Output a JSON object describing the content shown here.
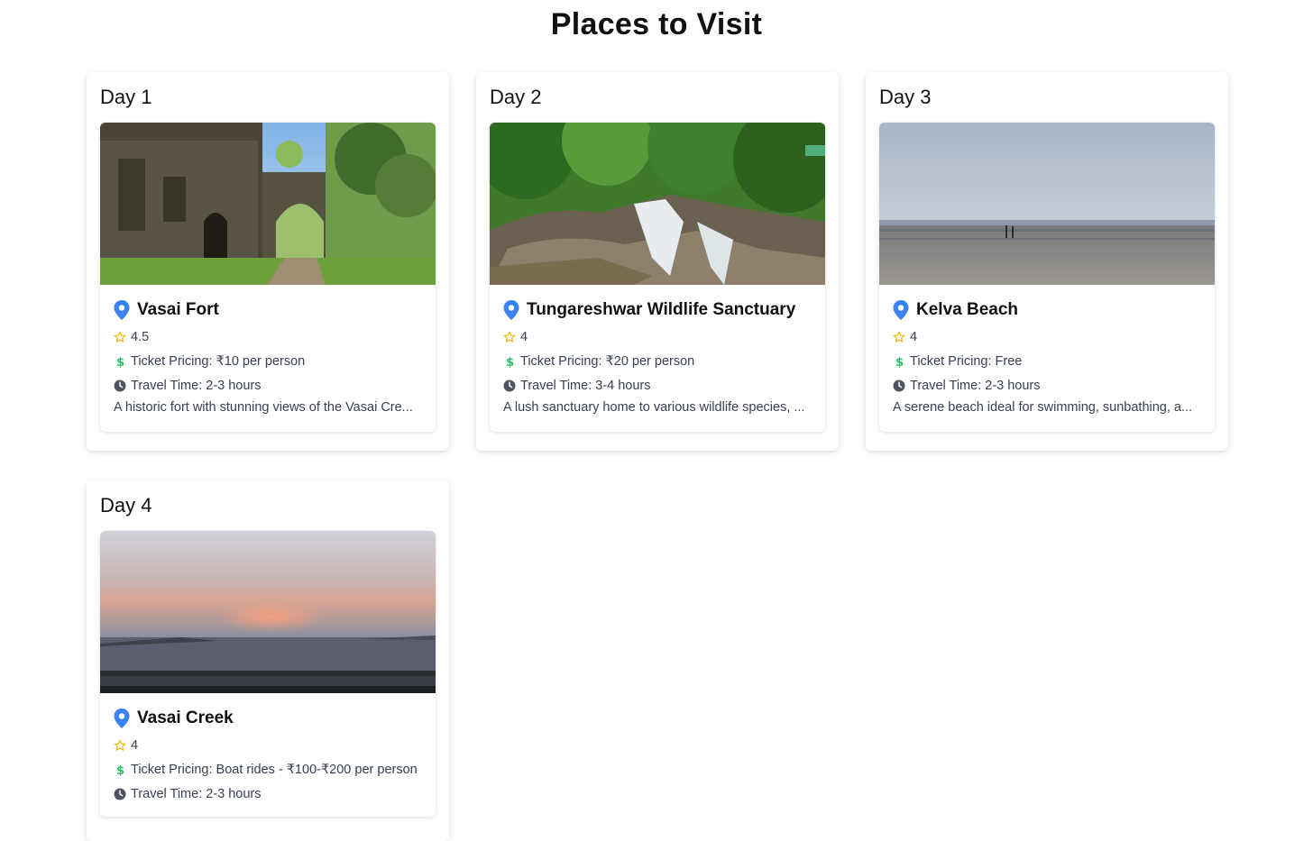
{
  "page": {
    "title": "Places to Visit"
  },
  "colors": {
    "pin": "#3b82f6",
    "star": "#f5b301",
    "dollar": "#22c55e",
    "clock": "#4b5563"
  },
  "days": [
    {
      "label": "Day 1",
      "place": {
        "name": "Vasai Fort",
        "rating": "4.5",
        "ticket": "Ticket Pricing: ₹10 per person",
        "travel": "Travel Time: 2-3 hours",
        "description": "A historic fort with stunning views of the Vasai Cre..."
      }
    },
    {
      "label": "Day 2",
      "place": {
        "name": "Tungareshwar Wildlife Sanctuary",
        "rating": "4",
        "ticket": "Ticket Pricing: ₹20 per person",
        "travel": "Travel Time: 3-4 hours",
        "description": "A lush sanctuary home to various wildlife species, ..."
      }
    },
    {
      "label": "Day 3",
      "place": {
        "name": "Kelva Beach",
        "rating": "4",
        "ticket": "Ticket Pricing: Free",
        "travel": "Travel Time: 2-3 hours",
        "description": "A serene beach ideal for swimming, sunbathing, a..."
      }
    },
    {
      "label": "Day 4",
      "place": {
        "name": "Vasai Creek",
        "rating": "4",
        "ticket": "Ticket Pricing: Boat rides - ₹100-₹200 per person",
        "travel": "Travel Time: 2-3 hours",
        "description": ""
      }
    }
  ]
}
